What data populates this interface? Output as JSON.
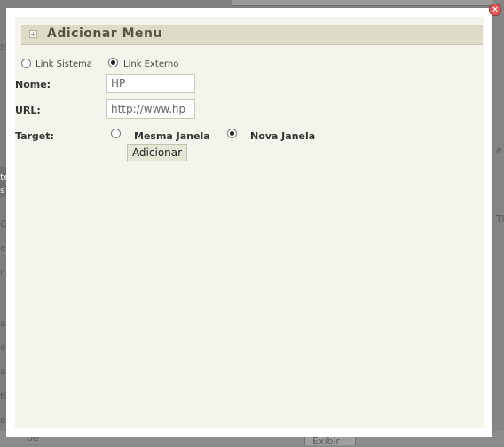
{
  "background": {
    "fragments": [
      "st",
      "te",
      "s",
      "G",
      "e",
      "r",
      "a",
      "e",
      "a",
      "ti",
      "os",
      "e",
      "Ti",
      "pe",
      "Exibir"
    ]
  },
  "dialog": {
    "title": "Adicionar Menu",
    "header_icon_symbol": "+",
    "close_symbol": "×",
    "link_type": {
      "options": [
        {
          "label": "Link Sistema",
          "checked": false
        },
        {
          "label": "Link Externo",
          "checked": true
        }
      ]
    },
    "fields": {
      "nome": {
        "label": "Nome:",
        "value": "HP"
      },
      "url": {
        "label": "URL:",
        "value": "http://www.hp"
      }
    },
    "target": {
      "label": "Target:",
      "options": [
        {
          "label": "Mesma Janela",
          "checked": false
        },
        {
          "label": "Nova Janela",
          "checked": true
        }
      ]
    },
    "submit_label": "Adicionar"
  },
  "colors": {
    "header_bg": "#dcdcc8",
    "panel_bg": "#f4f4ec",
    "close_red": "#e05a5a"
  }
}
